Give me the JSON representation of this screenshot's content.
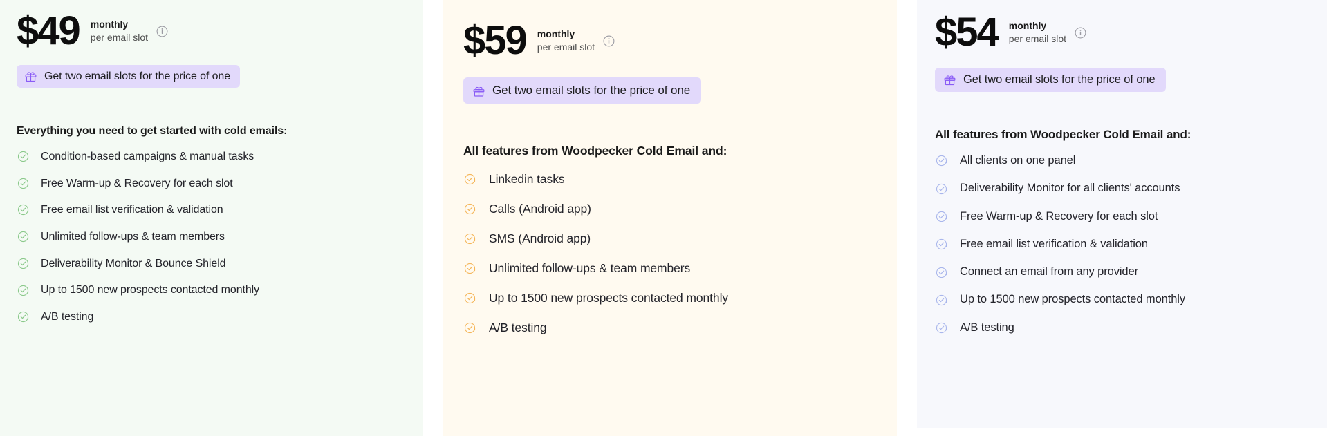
{
  "plans": [
    {
      "id": "starter",
      "price": "$49",
      "period": "monthly",
      "unit": "per email slot",
      "info_icon": "info-circle-icon",
      "promo": {
        "icon": "gift-icon",
        "text": "Get two email slots for the price of one"
      },
      "features_title": "Everything you need to get started with cold emails:",
      "check_icon": "check-circle-icon",
      "accent": "#8bc98b",
      "background": "#f4faf4",
      "features": [
        "Condition-based campaigns & manual tasks",
        "Free Warm-up & Recovery for each slot",
        "Free email list verification & validation",
        "Unlimited follow-ups & team members",
        "Deliverability Monitor & Bounce Shield",
        "Up to 1500 new prospects contacted monthly",
        "A/B testing"
      ]
    },
    {
      "id": "growth",
      "price": "$59",
      "period": "monthly",
      "unit": "per email slot",
      "info_icon": "info-circle-icon",
      "promo": {
        "icon": "gift-icon",
        "text": "Get two email slots for the price of one"
      },
      "features_title": "All features from Woodpecker Cold Email and:",
      "check_icon": "check-circle-icon",
      "accent": "#f5b65a",
      "background": "#fffaf0",
      "features": [
        "Linkedin tasks",
        "Calls (Android app)",
        "SMS (Android app)",
        "Unlimited follow-ups & team members",
        "Up to 1500 new prospects contacted monthly",
        "A/B testing"
      ]
    },
    {
      "id": "agency",
      "price": "$54",
      "period": "monthly",
      "unit": "per email slot",
      "info_icon": "info-circle-icon",
      "promo": {
        "icon": "gift-icon",
        "text": "Get two email slots for the price of one"
      },
      "features_title": "All features from Woodpecker Cold Email and:",
      "check_icon": "check-circle-icon",
      "accent": "#aab7ec",
      "background": "#f7f8fc",
      "features": [
        "All clients on one panel",
        "Deliverability Monitor for all clients' accounts",
        "Free Warm-up & Recovery for each slot",
        "Free email list verification & validation",
        "Connect an email from any provider",
        "Up to 1500 new prospects contacted monthly",
        "A/B testing"
      ]
    }
  ],
  "colors": {
    "promo_background": "#e2d9fb",
    "promo_icon": "#8a5cf6",
    "info_icon": "#9a9aa2",
    "text_primary": "#1a1a1a",
    "text_body": "#24242b"
  }
}
